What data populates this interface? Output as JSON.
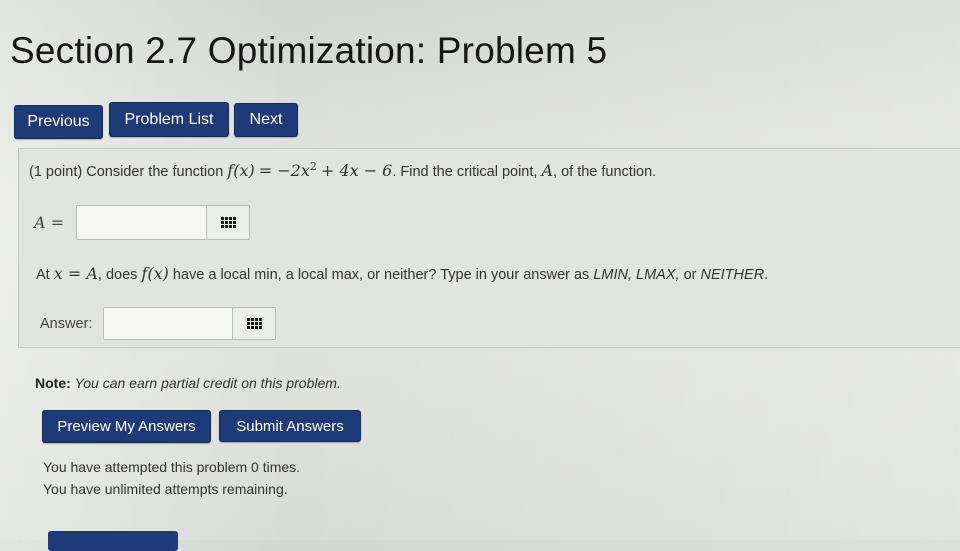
{
  "page": {
    "title": "Section 2.7 Optimization: Problem 5"
  },
  "nav": {
    "previous": "Previous",
    "problem_list": "Problem List",
    "next": "Next"
  },
  "problem": {
    "points": "(1 point)",
    "intro": "Consider the function",
    "function_lhs": "f(x)",
    "function_eq": "= −2x",
    "exponent": "2",
    "function_rest": "+ 4x − 6",
    "question": ". Find the critical point,",
    "point_symbol": "A",
    "question_end": ", of the function.",
    "answer_a_label": "A =",
    "answer_a_value": "",
    "q2_at": "At",
    "q2_x_eq_a": "x = A",
    "q2_does": ", does",
    "q2_fx": "f(x)",
    "q2_have": "have a local min, a local max, or neither? Type in your answer as",
    "q2_options": "LMIN, LMAX,",
    "q2_or": "or",
    "q2_neither": "NEITHER",
    "q2_period": ".",
    "answer_label": "Answer:",
    "answer_value": ""
  },
  "note": {
    "label": "Note:",
    "text": "You can earn partial credit on this problem."
  },
  "actions": {
    "preview": "Preview My Answers",
    "submit": "Submit Answers"
  },
  "status": {
    "attempted": "You have attempted this problem 0 times.",
    "remaining": "You have unlimited attempts remaining."
  },
  "colors": {
    "button_bg": "#1f3a78",
    "button_text": "#ffffff",
    "panel_bg": "#e2e4df"
  },
  "icons": {
    "palette": "equation-editor-grid-icon"
  }
}
